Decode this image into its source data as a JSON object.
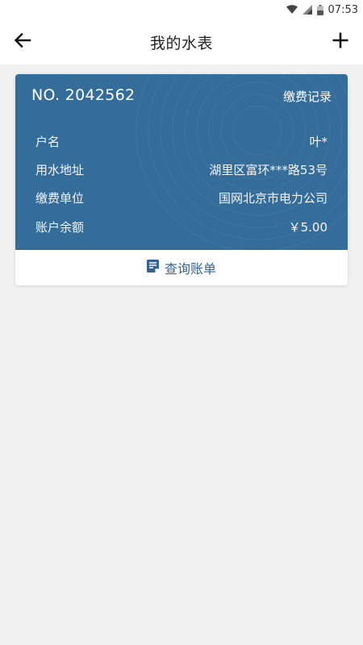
{
  "status_bar": {
    "time": "07:53",
    "icons": [
      "wifi-icon",
      "signal-icon",
      "battery-icon"
    ]
  },
  "app_bar": {
    "title": "我的水表",
    "back_icon": "arrow-left-icon",
    "add_icon": "plus-icon"
  },
  "meter_card": {
    "meter_no": "NO. 2042562",
    "record_link": "缴费记录",
    "rows": [
      {
        "label": "户名",
        "value": "叶*"
      },
      {
        "label": "用水地址",
        "value": "湖里区富环***路53号"
      },
      {
        "label": "缴费单位",
        "value": "国网北京市电力公司"
      },
      {
        "label": "账户余额",
        "value": "￥5.00"
      }
    ],
    "query_bill_label": "查询账单",
    "query_bill_icon": "bill-icon"
  },
  "colors": {
    "card_blue": "#346c9a",
    "link_blue": "#36638f",
    "background": "#f1f1f1"
  }
}
